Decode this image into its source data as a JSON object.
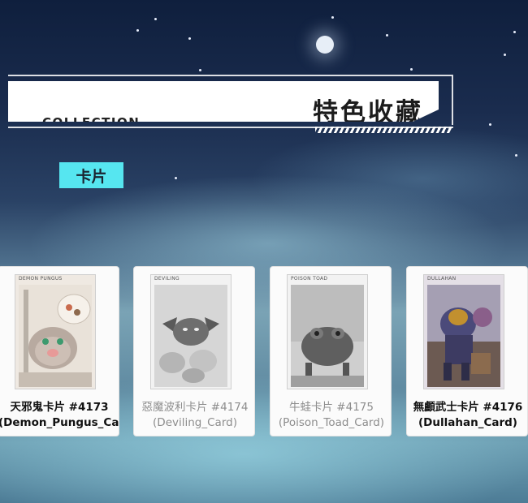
{
  "header": {
    "subtitle": "COLLECTION",
    "title": "特色收藏"
  },
  "category_tab": {
    "label": "卡片"
  },
  "cards": [
    {
      "art_title": "DEMON PUNGUS",
      "line1": "天邪鬼卡片 #4173",
      "line2": "(Demon_Pungus_Card)",
      "owned": true
    },
    {
      "art_title": "DEVILING",
      "line1": "惡魔波利卡片 #4174",
      "line2": "(Deviling_Card)",
      "owned": false
    },
    {
      "art_title": "POISON TOAD",
      "line1": "牛蛙卡片 #4175",
      "line2": "(Poison_Toad_Card)",
      "owned": false
    },
    {
      "art_title": "DULLAHAN",
      "line1": "無顱武士卡片 #4176",
      "line2": "(Dullahan_Card)",
      "owned": true
    }
  ]
}
